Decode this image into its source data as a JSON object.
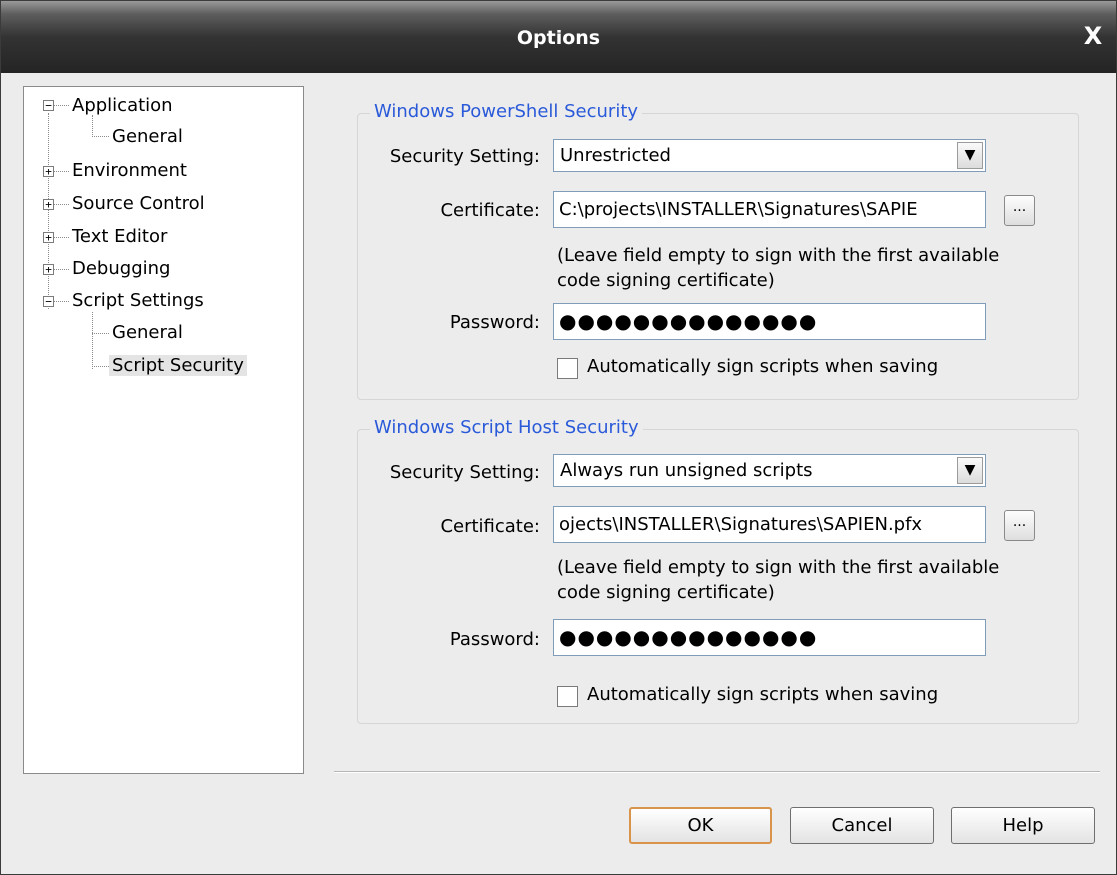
{
  "window": {
    "title": "Options",
    "close_symbol": "X"
  },
  "tree": {
    "items": [
      {
        "label": "Application",
        "expander": "−"
      },
      {
        "label": "General"
      },
      {
        "label": "Environment",
        "expander": "+"
      },
      {
        "label": "Source Control",
        "expander": "+"
      },
      {
        "label": "Text Editor",
        "expander": "+"
      },
      {
        "label": "Debugging",
        "expander": "+"
      },
      {
        "label": "Script Settings",
        "expander": "−"
      },
      {
        "label": "General"
      },
      {
        "label": "Script Security",
        "selected": true
      }
    ]
  },
  "powershell": {
    "legend": "Windows PowerShell Security",
    "security_label": "Security Setting:",
    "security_value": "Unrestricted",
    "certificate_label": "Certificate:",
    "certificate_value": "C:\\projects\\INSTALLER\\Signatures\\SAPIE",
    "browse_label": "...",
    "note_line1": "(Leave field empty to sign with the first available",
    "note_line2": "code signing certificate)",
    "password_label": "Password:",
    "password_value": "●●●●●●●●●●●●●●",
    "auto_sign_label": "Automatically sign scripts when saving"
  },
  "wsh": {
    "legend": "Windows Script Host Security",
    "security_label": "Security Setting:",
    "security_value": "Always run unsigned scripts",
    "certificate_label": "Certificate:",
    "certificate_value": "ojects\\INSTALLER\\Signatures\\SAPIEN.pfx",
    "browse_label": "...",
    "note_line1": "(Leave field empty to sign with the first available",
    "note_line2": "code signing certificate)",
    "password_label": "Password:",
    "password_value": "●●●●●●●●●●●●●●",
    "auto_sign_label": "Automatically sign scripts when saving"
  },
  "buttons": {
    "ok": "OK",
    "cancel": "Cancel",
    "help": "Help"
  },
  "icons": {
    "dropdown": "chevron-down-icon",
    "close": "close-icon"
  },
  "colors": {
    "legend": "#2a5ad9",
    "default_button_border": "#d8944a"
  }
}
